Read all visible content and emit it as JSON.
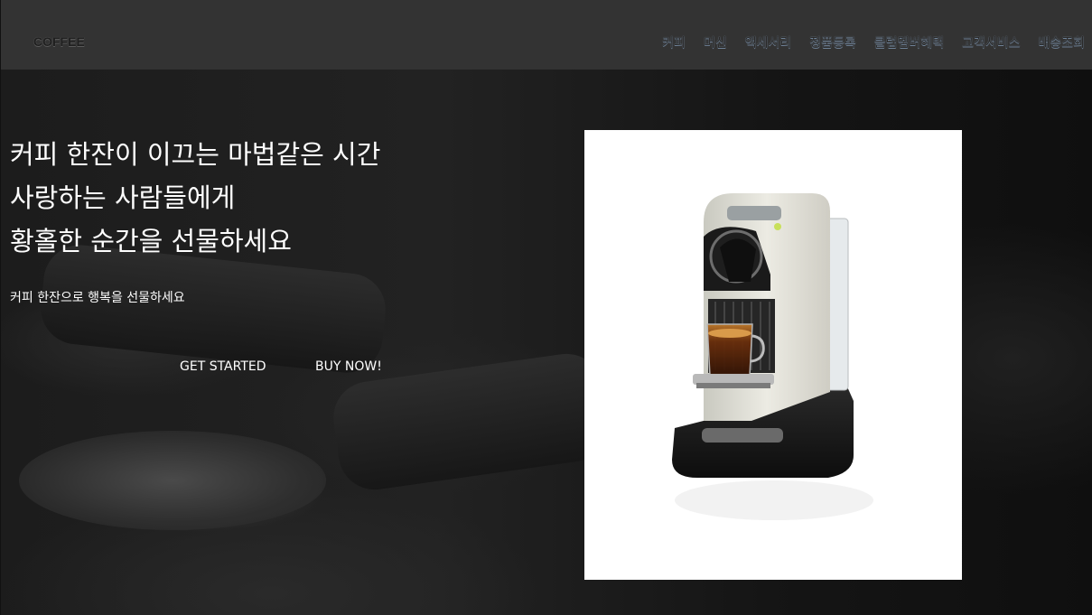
{
  "header": {
    "logo": "COFFEE",
    "nav": [
      {
        "label": "커피"
      },
      {
        "label": "머신"
      },
      {
        "label": "액세서리"
      },
      {
        "label": "정품등록"
      },
      {
        "label": "클럽멤버혜택"
      },
      {
        "label": "고객서비스"
      },
      {
        "label": "배송조회"
      }
    ]
  },
  "hero": {
    "headline": [
      "커피 한잔이 이끄는 마법같은 시간",
      "사랑하는 사람들에게",
      "황홀한 순간을 선물하세요"
    ],
    "subline": "커피 한잔으로 행복을 선물하세요",
    "buttons": {
      "start": "GET STARTED",
      "buy": "BUY NOW!"
    }
  },
  "product": {
    "image": "espresso-machine-white"
  }
}
